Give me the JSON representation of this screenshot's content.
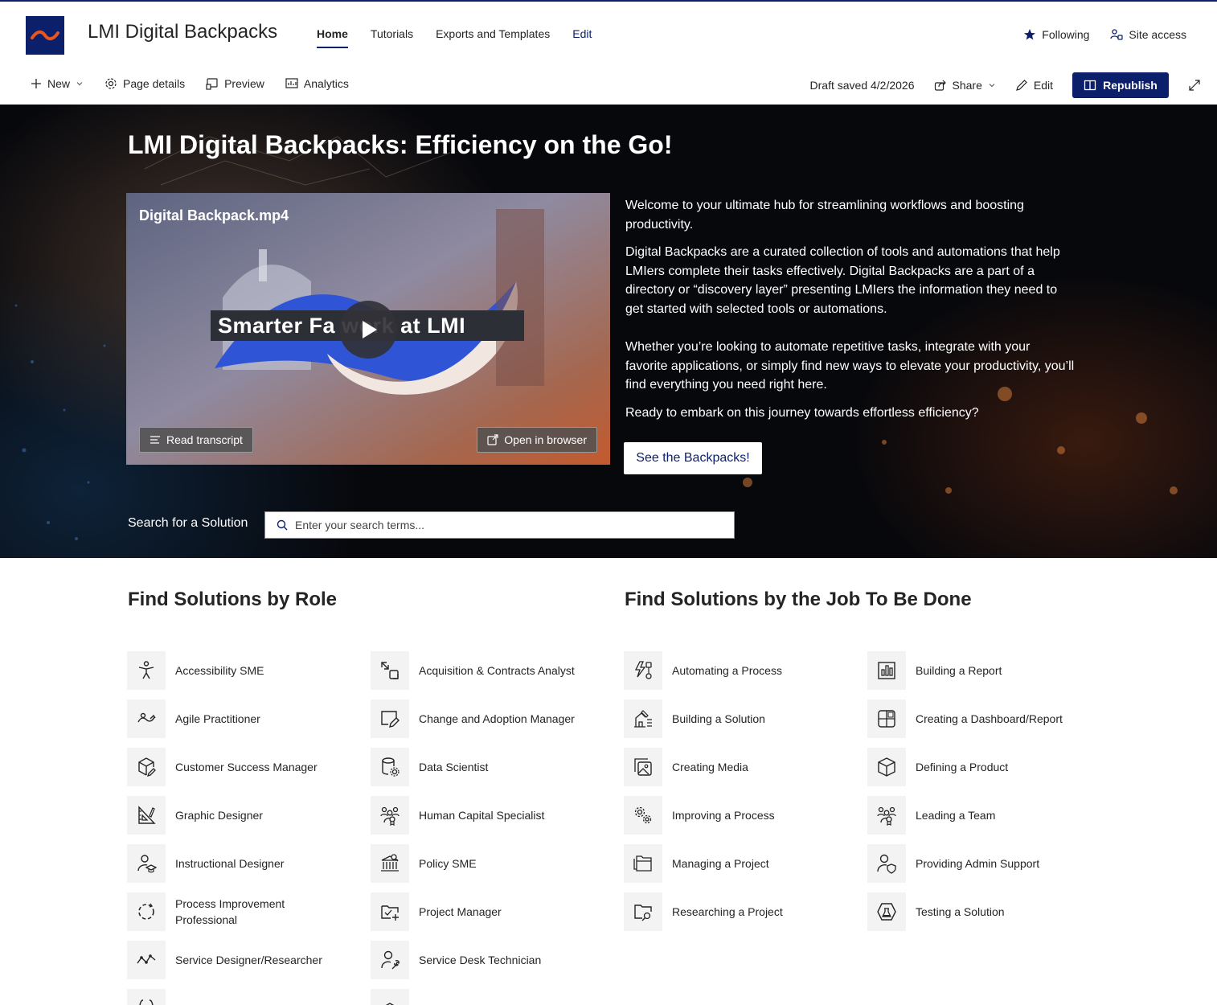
{
  "site": {
    "title": "LMI Digital Backpacks",
    "nav": [
      {
        "label": "Home",
        "active": true
      },
      {
        "label": "Tutorials"
      },
      {
        "label": "Exports and Templates"
      },
      {
        "label": "Edit"
      }
    ],
    "following": "Following",
    "site_access": "Site access"
  },
  "commandbar": {
    "new": "New",
    "page_details": "Page details",
    "preview": "Preview",
    "analytics": "Analytics",
    "draft_status": "Draft saved 4/2/2026",
    "share": "Share",
    "edit": "Edit",
    "republish": "Republish"
  },
  "hero": {
    "title": "LMI Digital Backpacks: Efficiency on the Go!",
    "video": {
      "filename": "Digital Backpack.mp4",
      "banner": "Smarter Fa     work at LMI",
      "read_transcript": "Read transcript",
      "open_in_browser": "Open in browser"
    },
    "paragraphs": [
      "Welcome to your ultimate hub for streamlining workflows and boosting productivity.",
      "Digital Backpacks are a curated collection of tools and automations that help LMIers complete their tasks effectively. Digital Backpacks are a part of a directory or “discovery layer” presenting LMIers the information they need to get started with selected tools or automations.",
      "Whether you’re looking to automate repetitive tasks, integrate with your favorite applications, or simply find new ways to elevate your productivity, you’ll find everything you need right here.",
      "Ready to embark on this journey towards effortless efficiency?"
    ],
    "cta": "See the Backpacks!",
    "search_label": "Search for a Solution",
    "search_placeholder": "Enter your search terms..."
  },
  "roles": {
    "title": "Find Solutions by Role",
    "items": [
      {
        "label": "Accessibility SME",
        "icon": "accessibility-icon"
      },
      {
        "label": "Acquisition & Contracts Analyst",
        "icon": "arrows-icon"
      },
      {
        "label": "Agile Practitioner",
        "icon": "agile-icon"
      },
      {
        "label": "Change and Adoption Manager",
        "icon": "edit-window-icon"
      },
      {
        "label": "Customer Success Manager",
        "icon": "box-edit-icon"
      },
      {
        "label": "Data Scientist",
        "icon": "database-gear-icon"
      },
      {
        "label": "Graphic Designer",
        "icon": "design-ruler-icon"
      },
      {
        "label": "Human Capital Specialist",
        "icon": "people-badge-icon"
      },
      {
        "label": "Instructional Designer",
        "icon": "person-graduation-icon"
      },
      {
        "label": "Policy SME",
        "icon": "building-search-icon"
      },
      {
        "label": "Process Improvement Professional",
        "icon": "dashed-circle-icon"
      },
      {
        "label": "Project Manager",
        "icon": "folder-add-icon"
      },
      {
        "label": "Service Designer/Researcher",
        "icon": "line-chart-icon"
      },
      {
        "label": "Service Desk Technician",
        "icon": "person-wrench-icon"
      }
    ]
  },
  "jobs": {
    "title": "Find Solutions by the Job To Be Done",
    "items": [
      {
        "label": "Automating a Process",
        "icon": "flash-flow-icon"
      },
      {
        "label": "Building a Report",
        "icon": "bar-chart-icon"
      },
      {
        "label": "Building a Solution",
        "icon": "building-solution-icon"
      },
      {
        "label": "Creating a Dashboard/Report",
        "icon": "dashboard-icon"
      },
      {
        "label": "Creating Media",
        "icon": "image-multiple-icon"
      },
      {
        "label": "Defining a Product",
        "icon": "cube-icon"
      },
      {
        "label": "Improving a Process",
        "icon": "gears-icon"
      },
      {
        "label": "Leading a Team",
        "icon": "team-icon"
      },
      {
        "label": "Managing a Project",
        "icon": "folder-stack-icon"
      },
      {
        "label": "Providing Admin Support",
        "icon": "person-shield-icon"
      },
      {
        "label": "Researching a Project",
        "icon": "folder-search-icon"
      },
      {
        "label": "Testing a Solution",
        "icon": "beaker-icon"
      }
    ]
  },
  "colors": {
    "brand": "#0b1f6b",
    "logo_wave": "#e8551e",
    "tile_bg": "#f3f3f3"
  }
}
